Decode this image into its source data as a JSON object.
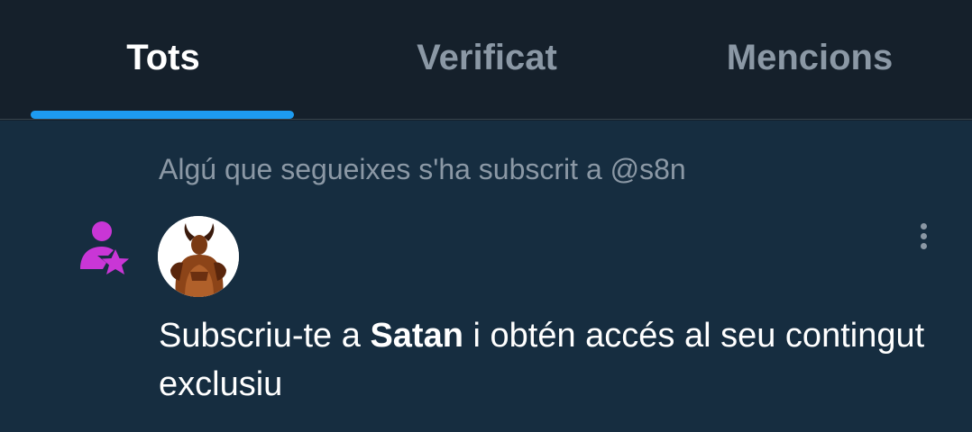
{
  "tabs": [
    {
      "label": "Tots",
      "active": true
    },
    {
      "label": "Verificat",
      "active": false
    },
    {
      "label": "Mencions",
      "active": false
    }
  ],
  "notification": {
    "context": "Algú que segueixes s'ha subscrit a @s8n",
    "message_before": "Subscriu-te a ",
    "message_name": "Satan",
    "message_after": " i obtén accés al seu contingut exclusiu",
    "icon": "person-star-icon",
    "icon_color": "#c936d6",
    "more_icon": "more-vertical-icon"
  },
  "colors": {
    "background": "#15202b",
    "notification_bg": "#162d40",
    "accent": "#1d9bf0",
    "muted_text": "#8b98a5",
    "text": "#ffffff"
  }
}
